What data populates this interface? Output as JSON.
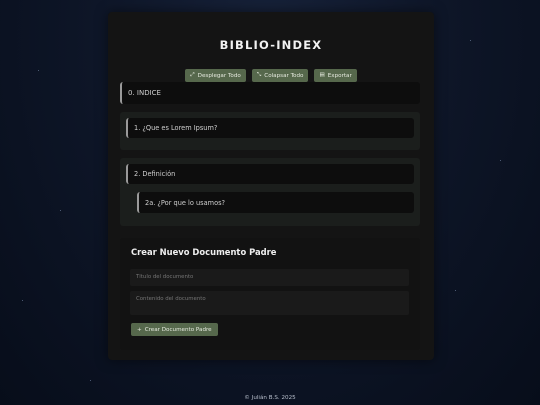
{
  "app": {
    "title": "BIBLIO-INDEX"
  },
  "toolbar": {
    "expand_label": "Desplegar Todo",
    "collapse_label": "Colapsar Todo",
    "export_label": "Exportar"
  },
  "documents": [
    {
      "title": "0. INDICE",
      "children": []
    },
    {
      "title": "1. ¿Que es Lorem Ipsum?",
      "children": []
    },
    {
      "title": "2. Definición",
      "children": [
        {
          "title": "2a. ¿Por que lo usamos?"
        }
      ]
    }
  ],
  "form": {
    "heading": "Crear Nuevo Documento Padre",
    "title_placeholder": "Título del documento",
    "content_placeholder": "Contenido del documento",
    "submit_label": "Crear Documento Padre"
  },
  "footer": {
    "copyright": "© Julián B.S. 2025"
  },
  "colors": {
    "accent_button": "#56684c",
    "panel": "#141414",
    "background": "#0e1628"
  },
  "icons": {
    "expand": "expand-arrows-icon",
    "collapse": "collapse-arrows-icon",
    "export": "export-document-icon",
    "add": "plus-icon"
  }
}
